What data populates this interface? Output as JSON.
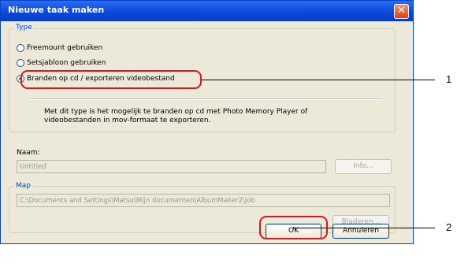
{
  "window": {
    "title": "Nieuwe taak maken"
  },
  "type_group": {
    "label": "Type",
    "options": [
      {
        "label": "Freemount gebruiken",
        "checked": false
      },
      {
        "label": "Setsjabloon gebruiken",
        "checked": false
      },
      {
        "label": "Branden op cd / exporteren videobestand",
        "checked": true
      }
    ],
    "description_line1": "Met dit type is het mogelijk te branden op cd met Photo Memory Player of",
    "description_line2": "videobestanden in mov-formaat te exporteren."
  },
  "naam": {
    "label": "Naam:",
    "value": "Untitled",
    "info_button": "Info..."
  },
  "map": {
    "label": "Map",
    "value": "C:\\Documents and Settings\\Matsu\\Mijn documenten\\AlbumMaker2\\Job",
    "browse_button": "Bladeren..."
  },
  "footer": {
    "ok_button": "OK",
    "cancel_button": "Annuleren"
  },
  "callouts": {
    "one": "1",
    "two": "2"
  },
  "colors": {
    "callout": "#e0141e",
    "title_bar": "#0a46d8",
    "dialog_bg": "#ece9d8"
  }
}
